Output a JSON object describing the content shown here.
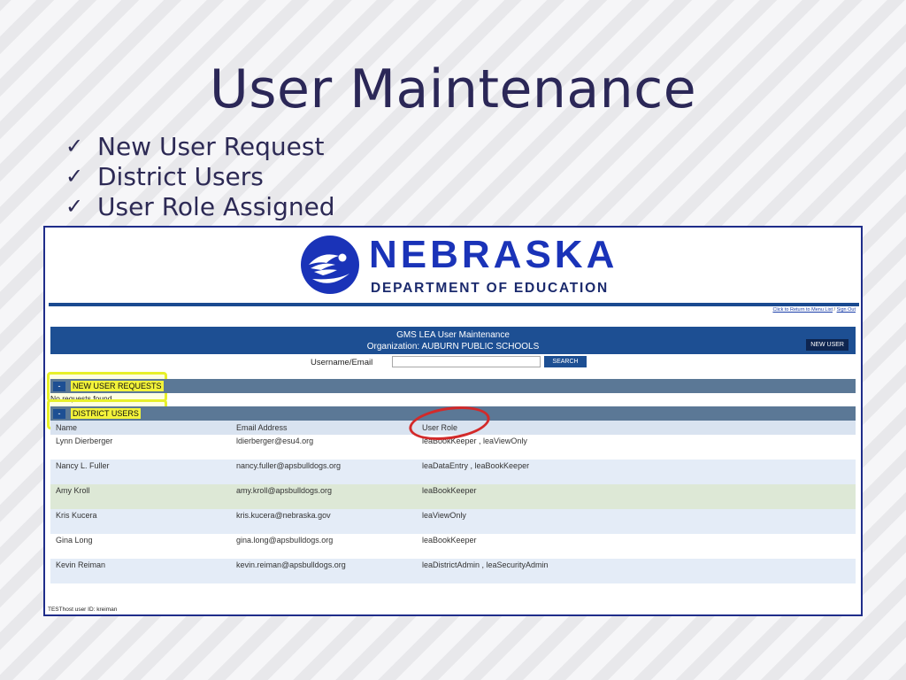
{
  "slide": {
    "title": "User Maintenance",
    "bullets": [
      "New User Request",
      "District Users",
      "User Role Assigned"
    ],
    "check_glyph": "✓"
  },
  "brand": {
    "name": "NEBRASKA",
    "subtitle": "DEPARTMENT OF EDUCATION",
    "colors": {
      "primary": "#1a33b8",
      "dark": "#1b2a6d"
    }
  },
  "toplinks": {
    "return_label": "Click to Return to Menu List",
    "separator": "/",
    "signout_label": "Sign Out"
  },
  "header": {
    "title": "GMS LEA User Maintenance",
    "organization": "Organization: AUBURN PUBLIC SCHOOLS",
    "new_user_label": "NEW USER"
  },
  "search": {
    "label": "Username/Email",
    "value": "",
    "button_label": "SEARCH"
  },
  "sections": {
    "new_requests": {
      "toggle": "-",
      "title": "NEW USER REQUESTS",
      "empty_text": "No requests found"
    },
    "district_users": {
      "toggle": "-",
      "title": "DISTRICT USERS"
    }
  },
  "table": {
    "columns": [
      "Name",
      "Email Address",
      "User Role"
    ],
    "rows": [
      {
        "name": "Lynn Dierberger",
        "email": "ldierberger@esu4.org",
        "role": "leaBookKeeper , leaViewOnly"
      },
      {
        "name": "Nancy L. Fuller",
        "email": "nancy.fuller@apsbulldogs.org",
        "role": "leaDataEntry , leaBookKeeper"
      },
      {
        "name": "Amy Kroll",
        "email": "amy.kroll@apsbulldogs.org",
        "role": "leaBookKeeper"
      },
      {
        "name": "Kris Kucera",
        "email": "kris.kucera@nebraska.gov",
        "role": "leaViewOnly"
      },
      {
        "name": "Gina Long",
        "email": "gina.long@apsbulldogs.org",
        "role": "leaBookKeeper"
      },
      {
        "name": "Kevin Reiman",
        "email": "kevin.reiman@apsbulldogs.org",
        "role": "leaDistrictAdmin , leaSecurityAdmin"
      }
    ]
  },
  "footer": {
    "host_text": "TESThost user ID: kreiman"
  },
  "colors": {
    "highlight_yellow": "#e7f02a",
    "highlight_red": "#d32a2a",
    "header_blue": "#1d4f93",
    "section_bar": "#5b7896"
  }
}
